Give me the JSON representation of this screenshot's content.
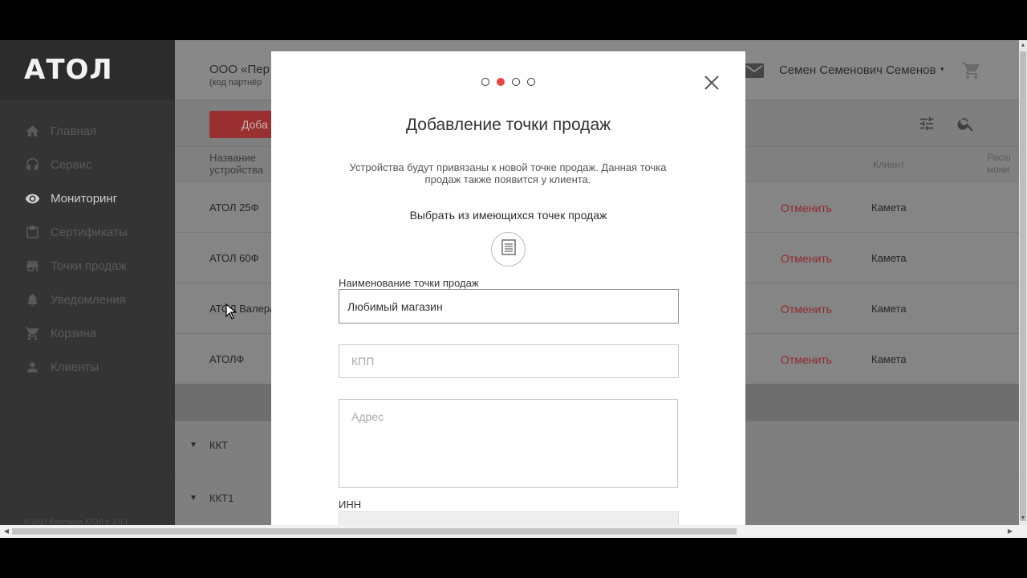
{
  "sidebar": {
    "logo": "АТОЛ",
    "items": [
      {
        "label": "Главная",
        "icon": "home-icon"
      },
      {
        "label": "Сервис",
        "icon": "headset-icon"
      },
      {
        "label": "Мониторинг",
        "icon": "eye-icon",
        "active": true
      },
      {
        "label": "Сертификаты",
        "icon": "clipboard-icon"
      },
      {
        "label": "Точки продаж",
        "icon": "store-icon"
      },
      {
        "label": "Уведомления",
        "icon": "bell-icon"
      },
      {
        "label": "Корзина",
        "icon": "cart-icon"
      },
      {
        "label": "Клиенты",
        "icon": "person-icon"
      }
    ],
    "copyright": "© 2017 Компания АТОЛ v. 2.0.1"
  },
  "header": {
    "org_name": "ООО «Пер",
    "org_code": "(код партнёр",
    "user_name": "Семен Семенович Семенов",
    "caret": "▾"
  },
  "toolbar": {
    "add_label": "Доба"
  },
  "table": {
    "headers": {
      "device": "Название устройства",
      "client": "Клиент",
      "ext": "Расш мони"
    },
    "rows": [
      {
        "name": "АТОЛ 25Ф",
        "action": "Отменить",
        "client": "Камета"
      },
      {
        "name": "АТОЛ 60Ф",
        "action": "Отменить",
        "client": "Камета"
      },
      {
        "name": "АТОЛ Валера",
        "action": "Отменить",
        "client": "Камета"
      },
      {
        "name": "АТОЛФ",
        "action": "Отменить",
        "client": "Камета"
      }
    ],
    "groups": [
      {
        "label": "ККТ",
        "caret": "▼"
      },
      {
        "label": "ККТ1",
        "caret": "▼"
      }
    ]
  },
  "modal": {
    "step_current": 2,
    "step_total": 4,
    "title": "Добавление точки продаж",
    "description": "Устройства будут привязаны к новой точке продаж. Данная точка продаж также появится у клиента.",
    "choose_existing": "Выбрать из имеющихся точек продаж",
    "fields": {
      "name_label": "Наименование точки продаж",
      "name_value": "Любимый магазин",
      "kpp_placeholder": "КПП",
      "address_placeholder": "Адрес",
      "inn_label": "ИНН"
    }
  },
  "colors": {
    "accent": "#e84545",
    "sidebar_bg": "#343434",
    "cancel_text": "#8f2a2a"
  }
}
